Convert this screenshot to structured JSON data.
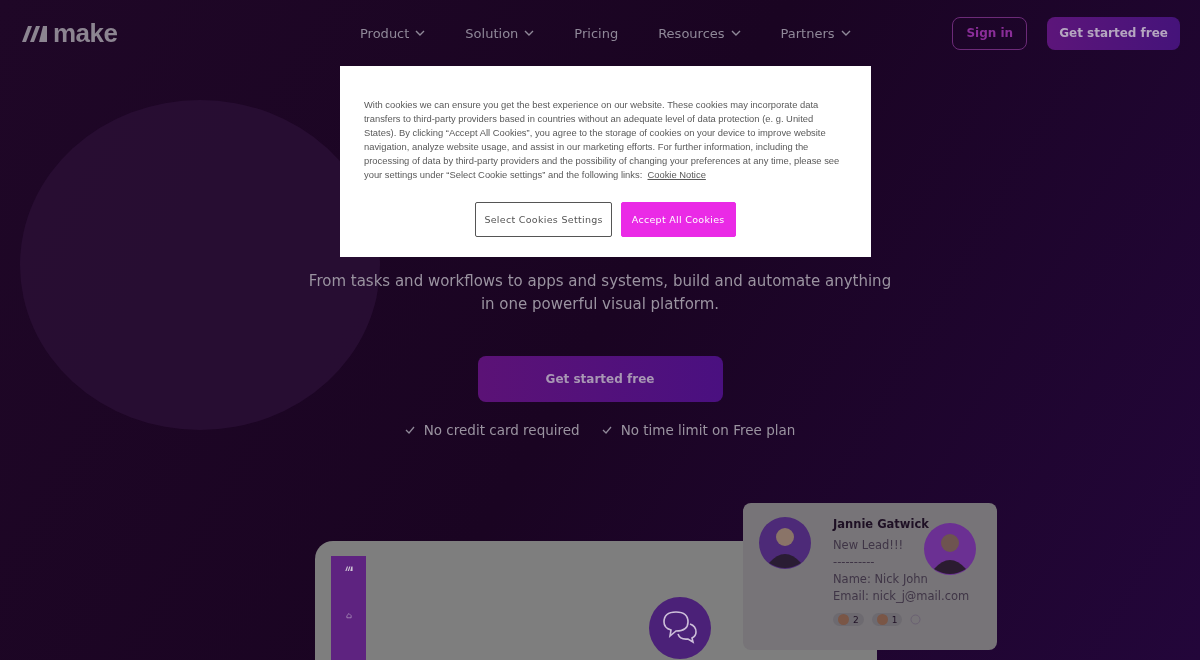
{
  "header": {
    "logo": "make",
    "nav": [
      {
        "label": "Product",
        "dropdown": true
      },
      {
        "label": "Solution",
        "dropdown": true
      },
      {
        "label": "Pricing",
        "dropdown": false
      },
      {
        "label": "Resources",
        "dropdown": true
      },
      {
        "label": "Partners",
        "dropdown": true
      }
    ],
    "sign_in": "Sign in",
    "cta": "Get started free"
  },
  "hero": {
    "subtitle": "From tasks and workflows to apps and systems, build and automate anything in one powerful visual platform.",
    "cta": "Get started free",
    "checks": [
      "No credit card required",
      "No time limit on Free plan"
    ]
  },
  "message_card": {
    "name": "Jannie Gatwick",
    "lines": [
      "New Lead!!!",
      "----------",
      "Name: Nick John",
      "Email: nick_j@mail.com"
    ],
    "reactions": [
      {
        "count": "2"
      },
      {
        "count": "1"
      }
    ]
  },
  "cookie_dialog": {
    "text": "With cookies we can ensure you get the best experience on our website. These cookies may incorporate data transfers to third-party providers based in countries without an adequate level of data protection (e. g. United States). By clicking “Accept All Cookies”, you agree to the storage of cookies on your device to improve website navigation, analyze website usage, and assist in our marketing efforts. For further information, including the processing of data by third-party providers and the possibility of changing your preferences at any time, please see your settings under “Select Cookie settings” and the following links:",
    "link": "Cookie Notice",
    "buttons": [
      {
        "label": "Select Cookies Settings",
        "kind": "secondary"
      },
      {
        "label": "Accept All Cookies",
        "kind": "primary"
      }
    ]
  }
}
